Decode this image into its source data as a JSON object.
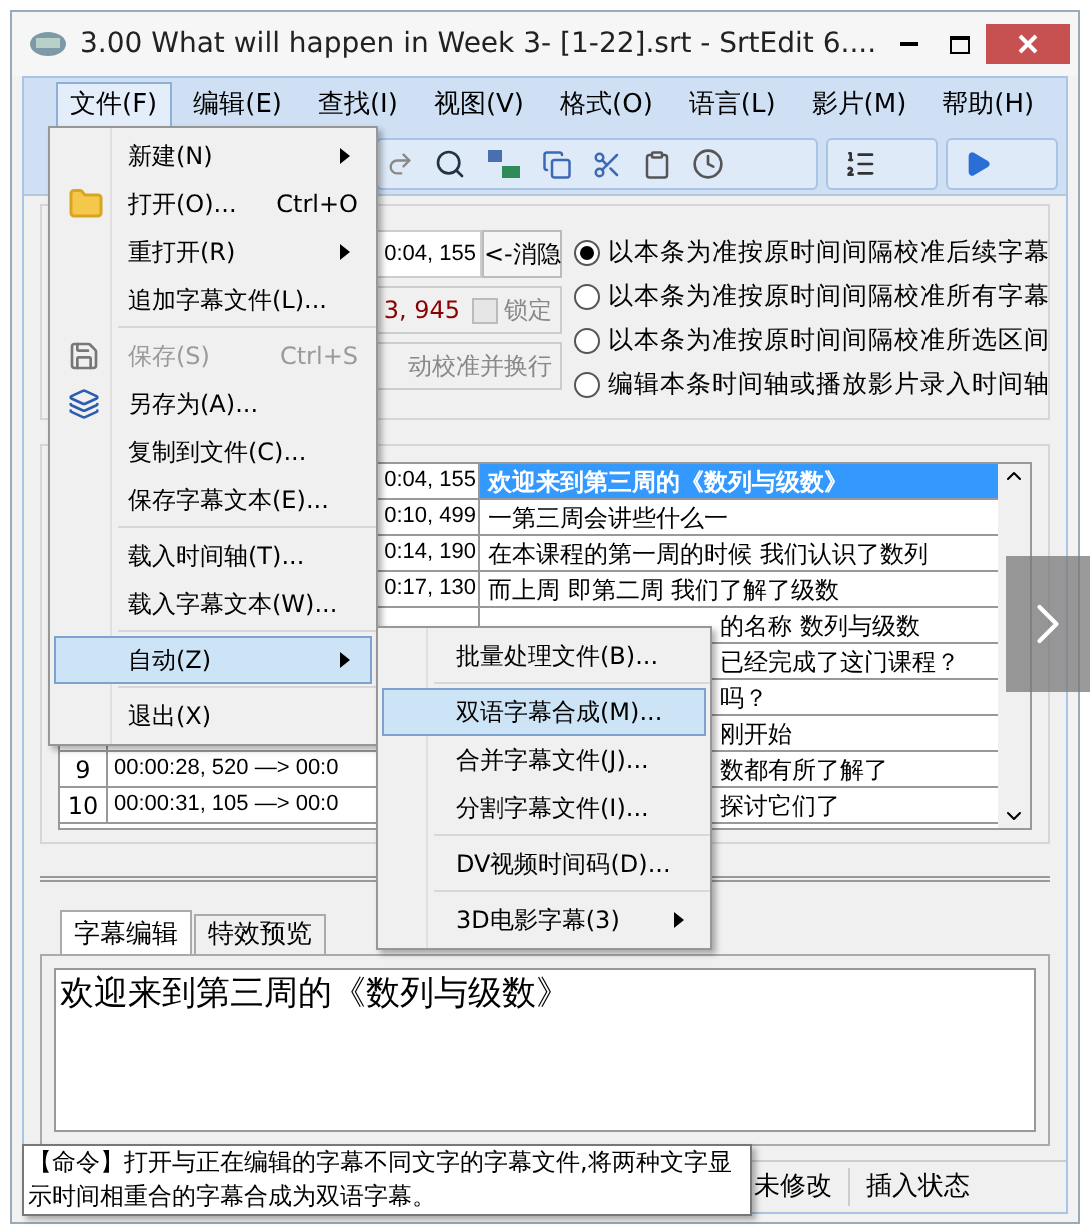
{
  "window": {
    "title": "3.00 What will happen in Week 3- [1-22].srt - SrtEdit 6...."
  },
  "menu_bar": [
    {
      "label": "文件(F)",
      "selected": true
    },
    {
      "label": "编辑(E)",
      "selected": false
    },
    {
      "label": "查找(I)",
      "selected": false
    },
    {
      "label": "视图(V)",
      "selected": false
    },
    {
      "label": "格式(O)",
      "selected": false
    },
    {
      "label": "语言(L)",
      "selected": false
    },
    {
      "label": "影片(M)",
      "selected": false
    },
    {
      "label": "帮助(H)",
      "selected": false
    }
  ],
  "file_menu": [
    {
      "kind": "item",
      "label": "新建(N)",
      "submenu": true,
      "disabled": false,
      "selected": false
    },
    {
      "kind": "item",
      "label": "打开(O)...",
      "shortcut": "Ctrl+O",
      "submenu": false,
      "disabled": false,
      "selected": false
    },
    {
      "kind": "item",
      "label": "重打开(R)",
      "submenu": true,
      "disabled": false,
      "selected": false
    },
    {
      "kind": "item",
      "label": "追加字幕文件(L)...",
      "submenu": false,
      "disabled": false,
      "selected": false
    },
    {
      "kind": "separator"
    },
    {
      "kind": "item",
      "label": "保存(S)",
      "shortcut": "Ctrl+S",
      "submenu": false,
      "disabled": true,
      "selected": false
    },
    {
      "kind": "item",
      "label": "另存为(A)...",
      "submenu": false,
      "disabled": false,
      "selected": false
    },
    {
      "kind": "item",
      "label": "复制到文件(C)...",
      "submenu": false,
      "disabled": false,
      "selected": false
    },
    {
      "kind": "item",
      "label": "保存字幕文本(E)...",
      "submenu": false,
      "disabled": false,
      "selected": false
    },
    {
      "kind": "separator"
    },
    {
      "kind": "item",
      "label": "载入时间轴(T)...",
      "submenu": false,
      "disabled": false,
      "selected": false
    },
    {
      "kind": "item",
      "label": "载入字幕文本(W)...",
      "submenu": false,
      "disabled": false,
      "selected": false
    },
    {
      "kind": "separator"
    },
    {
      "kind": "item",
      "label": "自动(Z)",
      "submenu": true,
      "disabled": false,
      "selected": true
    },
    {
      "kind": "separator"
    },
    {
      "kind": "item",
      "label": "退出(X)",
      "submenu": false,
      "disabled": false,
      "selected": false
    }
  ],
  "auto_submenu": [
    {
      "kind": "item",
      "label": "批量处理文件(B)...",
      "submenu": false,
      "selected": false
    },
    {
      "kind": "separator"
    },
    {
      "kind": "item",
      "label": "双语字幕合成(M)...",
      "submenu": false,
      "selected": true
    },
    {
      "kind": "item",
      "label": "合并字幕文件(J)...",
      "submenu": false,
      "selected": false
    },
    {
      "kind": "item",
      "label": "分割字幕文件(I)...",
      "submenu": false,
      "selected": false
    },
    {
      "kind": "separator"
    },
    {
      "kind": "item",
      "label": "DV视频时间码(D)...",
      "submenu": false,
      "selected": false
    },
    {
      "kind": "separator"
    },
    {
      "kind": "item",
      "label": "3D电影字幕(3)",
      "submenu": true,
      "selected": false
    }
  ],
  "timing_panel": {
    "time_field": "0:04, 155",
    "hide_button": "<-消隐",
    "duration_field": "3, 945",
    "lock_checkbox": {
      "label": "锁定",
      "checked": false
    },
    "calibrate_button": "动校准并换行",
    "options": [
      {
        "label": "以本条为准按原时间间隔校准后续字幕",
        "selected": true
      },
      {
        "label": "以本条为准按原时间间隔校准所有字幕",
        "selected": false
      },
      {
        "label": "以本条为准按原时间间隔校准所选区间",
        "selected": false
      },
      {
        "label": "编辑本条时间轴或播放影片录入时间轴",
        "selected": false
      }
    ]
  },
  "subtitle_table": [
    {
      "time": "0:04, 155",
      "text": "欢迎来到第三周的《数列与级数》",
      "selected": true
    },
    {
      "time": "0:10, 499",
      "text": "一第三周会讲些什么一",
      "selected": false
    },
    {
      "time": "0:14, 190",
      "text": "在本课程的第一周的时候  我们认识了数列",
      "selected": false
    },
    {
      "time": "0:17, 130",
      "text": "而上周  即第二周  我们了解了级数",
      "selected": false
    },
    {
      "text": "的名称  数列与级数",
      "selected": false
    },
    {
      "text": "已经完成了这门课程？",
      "selected": false
    },
    {
      "text": "吗？",
      "selected": false
    },
    {
      "text": "刚开始",
      "selected": false
    },
    {
      "number": "9",
      "time": "00:00:28, 520  —>  00:0",
      "text": "数都有所了解了",
      "selected": false
    },
    {
      "number": "10",
      "time": "00:00:31, 105  —>  00:0",
      "text": "探讨它们了",
      "selected": false
    }
  ],
  "editor_tabs": [
    {
      "label": "字幕编辑",
      "selected": true
    },
    {
      "label": "特效预览",
      "selected": false
    }
  ],
  "editor_text": "欢迎来到第三周的《数列与级数》",
  "status_bar": [
    "未修改",
    "插入状态"
  ],
  "tooltip": "【命令】打开与正在编辑的字幕不同文字的字幕文件,将两种文字显示时间相重合的字幕合成为双语字幕。"
}
